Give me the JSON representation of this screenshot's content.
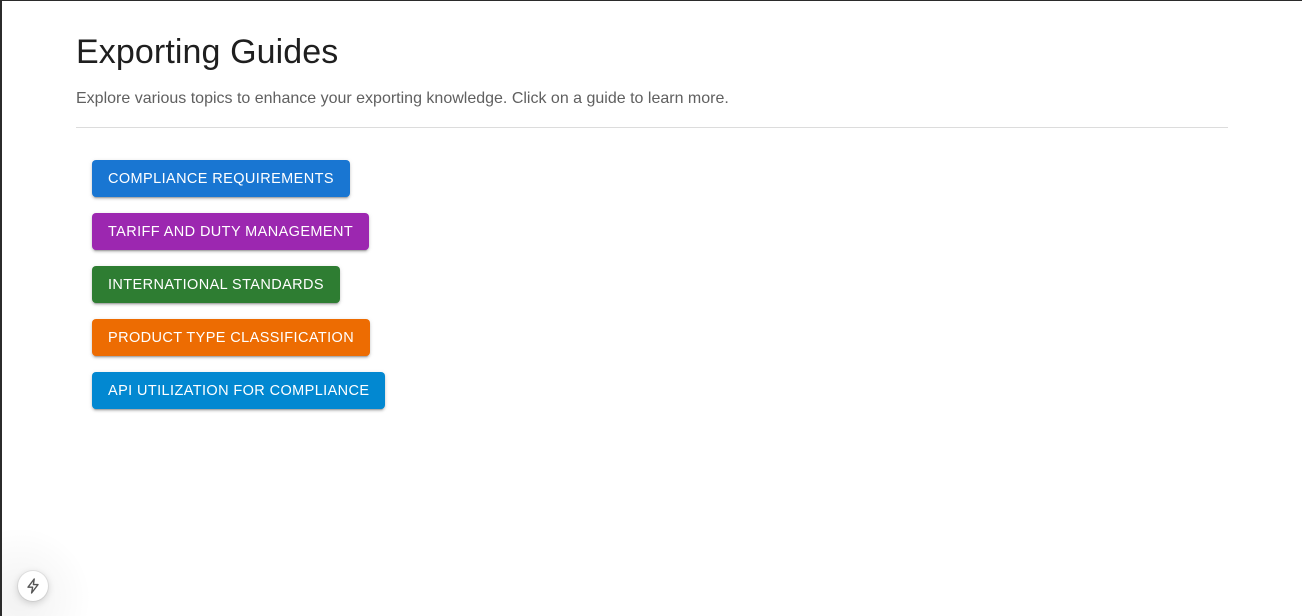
{
  "page": {
    "title": "Exporting Guides",
    "subtitle": "Explore various topics to enhance your exporting knowledge. Click on a guide to learn more."
  },
  "guides": [
    {
      "label": "COMPLIANCE REQUIREMENTS",
      "color": "#1976d2"
    },
    {
      "label": "TARIFF AND DUTY MANAGEMENT",
      "color": "#9c27b0"
    },
    {
      "label": "INTERNATIONAL STANDARDS",
      "color": "#2e7d32"
    },
    {
      "label": "PRODUCT TYPE CLASSIFICATION",
      "color": "#ed6c02"
    },
    {
      "label": "API UTILIZATION FOR COMPLIANCE",
      "color": "#0288d1"
    }
  ],
  "dev_badge": {
    "icon": "lightning-bolt-icon"
  }
}
